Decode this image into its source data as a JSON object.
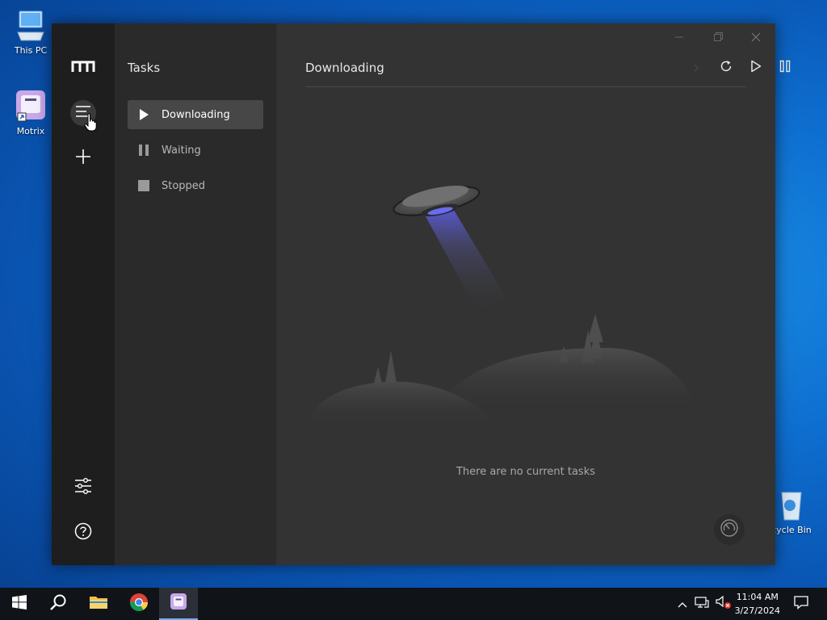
{
  "desktop": {
    "icons": [
      {
        "label": "This PC"
      },
      {
        "label": "Motrix"
      },
      {
        "label": "cycle Bin"
      }
    ]
  },
  "sidebar": {
    "title": "Tasks",
    "items": [
      {
        "label": "Downloading"
      },
      {
        "label": "Waiting"
      },
      {
        "label": "Stopped"
      }
    ]
  },
  "main": {
    "title": "Downloading",
    "empty_text": "There are no current tasks"
  },
  "taskbar": {
    "time": "11:04 AM",
    "date": "3/27/2024"
  },
  "colors": {
    "accent_ufo_beam": "#5b5be0",
    "rail_bg": "#1e1e1e",
    "nav_bg": "#2a2a2a",
    "main_bg": "#333333"
  }
}
